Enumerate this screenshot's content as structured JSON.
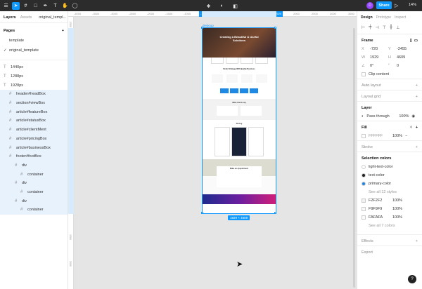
{
  "toolbar": {
    "avatar_initial": "D",
    "share_label": "Share",
    "zoom_label": "14%"
  },
  "left_panel": {
    "tabs": [
      "Layers",
      "Assets"
    ],
    "file_name": "original_templ...",
    "pages_title": "Pages",
    "pages": [
      {
        "label": "template",
        "checked": false
      },
      {
        "label": "original_template",
        "checked": true
      }
    ],
    "layers": [
      {
        "label": "1440px",
        "icon": "text",
        "indent": 0,
        "state": ""
      },
      {
        "label": "1288px",
        "icon": "text",
        "indent": 0,
        "state": ""
      },
      {
        "label": "1928px",
        "icon": "text",
        "indent": 0,
        "state": ""
      },
      {
        "label": "desktop",
        "icon": "frame",
        "indent": 0,
        "state": "sel"
      },
      {
        "label": "header#headBox",
        "icon": "frame",
        "indent": 1,
        "state": "sel2"
      },
      {
        "label": "section#viewBox",
        "icon": "frame",
        "indent": 1,
        "state": "sel2"
      },
      {
        "label": "article#featureBox",
        "icon": "frame",
        "indent": 1,
        "state": "sel2"
      },
      {
        "label": "article#statusBox",
        "icon": "frame",
        "indent": 1,
        "state": "sel2"
      },
      {
        "label": "article#clientMent",
        "icon": "frame",
        "indent": 1,
        "state": "sel2"
      },
      {
        "label": "article#pricingBox",
        "icon": "frame",
        "indent": 1,
        "state": "sel2"
      },
      {
        "label": "article#businessBox",
        "icon": "frame",
        "indent": 1,
        "state": "sel2"
      },
      {
        "label": "footer#footBox",
        "icon": "frame",
        "indent": 1,
        "state": "sel2"
      },
      {
        "label": "div",
        "icon": "frame",
        "indent": 2,
        "state": "sel2"
      },
      {
        "label": "container",
        "icon": "frame",
        "indent": 3,
        "state": "sel2"
      },
      {
        "label": "div",
        "icon": "frame",
        "indent": 2,
        "state": "sel2"
      },
      {
        "label": "container",
        "icon": "frame",
        "indent": 3,
        "state": "sel2"
      },
      {
        "label": "div",
        "icon": "frame",
        "indent": 2,
        "state": "sel2"
      },
      {
        "label": "container",
        "icon": "frame",
        "indent": 3,
        "state": "sel2"
      }
    ]
  },
  "ruler": {
    "top_labels": [
      "-4000",
      "-3500",
      "-3000",
      "-2500",
      "-2000",
      "-1500",
      "-1000",
      "-500",
      "0",
      "500",
      "1000",
      "1500",
      "2000",
      "2500",
      "3000",
      "3500"
    ],
    "selected_left": "-720",
    "selected_right": "1929",
    "left_labels": [
      "-2500",
      "-2000",
      "-1500",
      "-1000",
      "-500",
      "0",
      "500",
      "1000",
      "1500",
      "2000"
    ]
  },
  "canvas": {
    "frame_name": "desktop",
    "size_badge": "1929 × 4609",
    "hero_title": "Creating a Beautiful & Useful Solutions",
    "section2_title": "Better Strategy With Quality Business",
    "section3_title": "What clients say",
    "section4_title": "Pricing",
    "section5_title": "Make an Appointment"
  },
  "right_panel": {
    "tabs": [
      "Design",
      "Prototype",
      "Inspect"
    ],
    "frame_title": "Frame",
    "x_label": "X",
    "x_value": "-720",
    "y_label": "Y",
    "y_value": "-2455",
    "w_label": "W",
    "w_value": "1929",
    "h_label": "H",
    "h_value": "4609",
    "rotation_value": "0°",
    "radius_value": "0",
    "clip_content": "Clip content",
    "auto_layout": "Auto layout",
    "layout_grid": "Layout grid",
    "layer_title": "Layer",
    "blend_mode": "Pass through",
    "layer_opacity": "100%",
    "fill_title": "Fill",
    "fill_hex": "FFFFFF",
    "fill_opacity": "100%",
    "stroke_title": "Stroke",
    "selection_colors_title": "Selection colors",
    "style_colors": [
      {
        "label": "light-text-color",
        "color": "#ffffff"
      },
      {
        "label": "text-color",
        "color": "#222222"
      },
      {
        "label": "primary-color",
        "color": "#1e88e5"
      }
    ],
    "see_all_styles": "See all 12 styles",
    "raw_colors": [
      {
        "hex": "F2F2F2",
        "opacity": "100%",
        "color": "#F2F2F2"
      },
      {
        "hex": "F9F9F9",
        "opacity": "100%",
        "color": "#F9F9F9"
      },
      {
        "hex": "FAFAFA",
        "opacity": "100%",
        "color": "#FAFAFA"
      }
    ],
    "see_all_colors": "See all 7 colors",
    "effects_title": "Effects",
    "export_title": "Export"
  },
  "colors": {
    "accent": "#0d99ff",
    "toolbar_bg": "#2c2c2c",
    "canvas_bg": "#e5e5e5"
  }
}
